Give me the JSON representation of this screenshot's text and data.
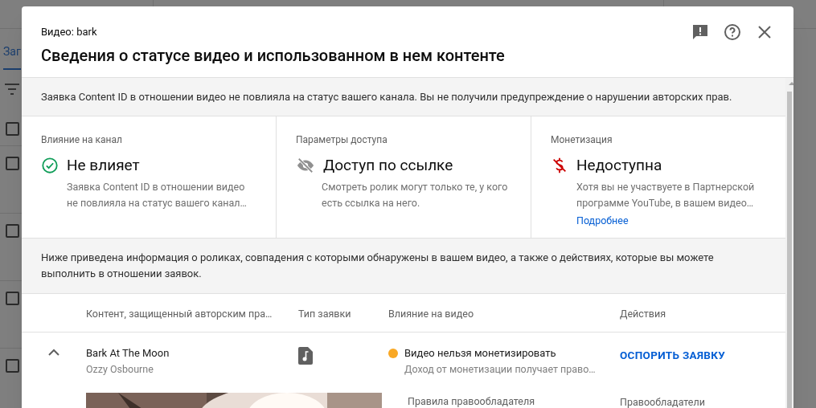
{
  "background": {
    "tab_label": "Заг",
    "row_checkboxes": [
      {
        "checked": false
      },
      {
        "checked": false
      },
      {
        "checked": false
      },
      {
        "checked": false
      },
      {
        "checked": false
      }
    ]
  },
  "dialog": {
    "subtitle": "Видео: bark",
    "title": "Сведения о статусе видео и использованном в нем контенте",
    "notice": "Заявка Content ID в отношении видео не повлияла на статус вашего канала. Вы не получили предупреждение о нарушении авторских прав.",
    "status_cards": [
      {
        "kind": "ok",
        "label": "Влияние на канал",
        "value": "Не влияет",
        "description": "Заявка Content ID в отношении видео не повлияла на статус вашего канал…"
      },
      {
        "kind": "unlisted",
        "label": "Параметры доступа",
        "value": "Доступ по ссылке",
        "description": "Смотреть ролик могут только те, у кого есть ссылка на него."
      },
      {
        "kind": "no_money",
        "label": "Монетизация",
        "value": "Недоступна",
        "description": "Хотя вы не участвуете в Партнерской программе YouTube, в вашем видео…",
        "link": "Подробнее"
      }
    ],
    "claims_intro": "Ниже приведена информация о роликах, совпадения с которыми обнаружены в вашем видео, а также о действиях, которые вы можете выполнить в отношении заявок.",
    "table": {
      "columns": [
        "Контент, защищенный авторским пра…",
        "Тип заявки",
        "Влияние на видео",
        "Действия"
      ],
      "rows": [
        {
          "expanded": true,
          "title": "Bark At The Moon",
          "artist": "Ozzy Osbourne",
          "claim_type": {
            "kind": "music"
          },
          "impact": "Видео нельзя монетизировать",
          "color": "#f9a825",
          "impact_detail": "Доход от монетизации получает право…",
          "action": "ОСПОРИТЬ ЗАЯВКУ",
          "detail_labels": [
            "Правила правообладателя",
            "Правообладатели"
          ]
        }
      ]
    }
  }
}
